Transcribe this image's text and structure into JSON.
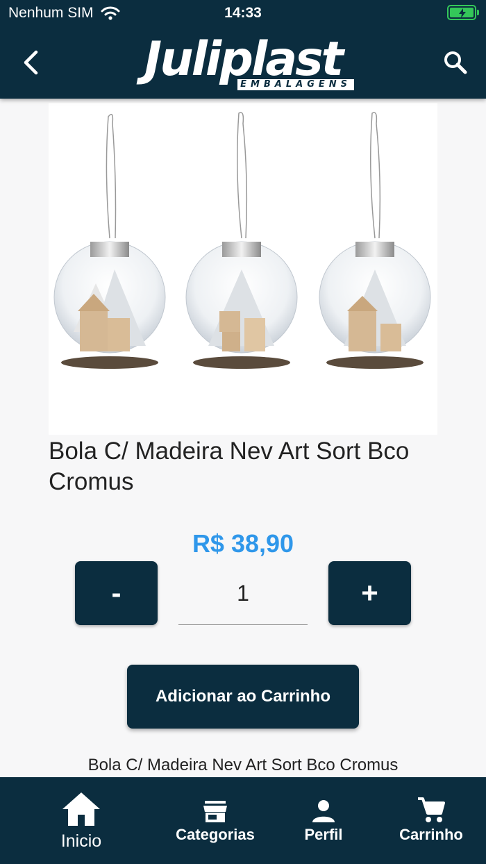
{
  "status": {
    "carrier": "Nenhum SIM",
    "time": "14:33"
  },
  "header": {
    "brand": "Juliplast",
    "brand_sub": "EMBALAGENS"
  },
  "product": {
    "title": "Bola C/ Madeira Nev Art Sort Bco Cromus",
    "price": "R$ 38,90",
    "quantity": "1",
    "minus_label": "-",
    "plus_label": "+",
    "add_to_cart_label": "Adicionar ao Carrinho",
    "description": "Bola C/ Madeira Nev Art Sort Bco Cromus"
  },
  "tabs": [
    {
      "label": "Inicio",
      "icon": "home-icon",
      "active": true
    },
    {
      "label": "Categorias",
      "icon": "store-icon"
    },
    {
      "label": "Perfil",
      "icon": "person-icon"
    },
    {
      "label": "Carrinho",
      "icon": "cart-icon"
    }
  ],
  "colors": {
    "primary": "#0b2d3f",
    "price": "#2f97ea",
    "battery": "#34c759"
  }
}
